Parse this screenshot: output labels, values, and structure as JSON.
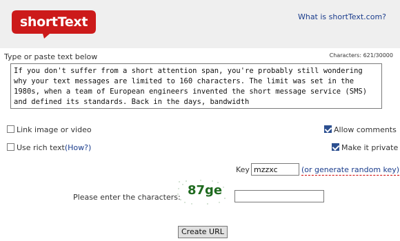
{
  "header": {
    "logo_text": "shortText",
    "what_link": "What is shortText.com?",
    "brand_color": "#cc1a1a",
    "background": "#efefef"
  },
  "editor": {
    "label": "Type or paste text below",
    "char_count": "Characters: 621/30000",
    "text": "If you don't suffer from a short attention span, you're probably still wondering why your text messages are limited to 160 characters. The limit was set in the 1980s, when a team of European engineers invented the short message service (SMS) and defined its standards. Back in the days, bandwidth"
  },
  "options": {
    "link_media": {
      "label": "Link image or video",
      "checked": false
    },
    "rich_text": {
      "label": "Use rich text",
      "link": "(How?)",
      "checked": false
    },
    "allow_comments": {
      "label": "Allow comments",
      "checked": true
    },
    "make_private": {
      "label": "Make it private",
      "checked": true
    }
  },
  "key": {
    "label": "Key",
    "value": "mzzxc",
    "generate_link": "(or generate random key)"
  },
  "captcha": {
    "label": "Please enter the characters:",
    "text": "87ge",
    "input_value": ""
  },
  "actions": {
    "create_label": "Create URL"
  }
}
